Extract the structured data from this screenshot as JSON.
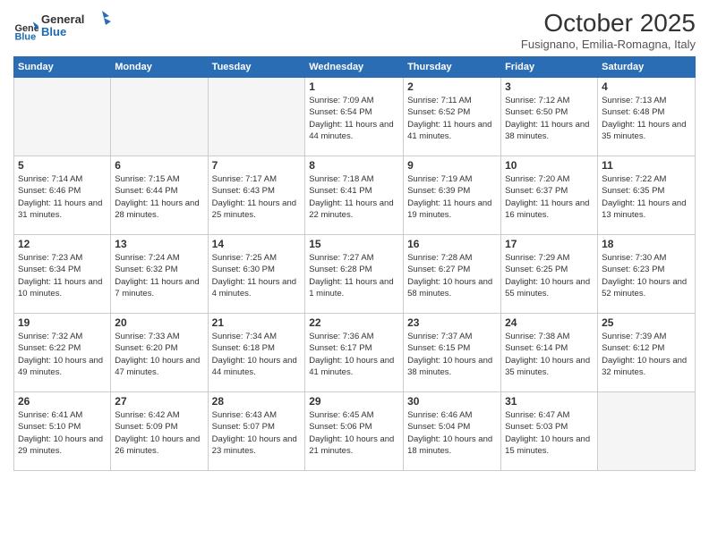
{
  "header": {
    "logo_line1": "General",
    "logo_line2": "Blue",
    "month": "October 2025",
    "location": "Fusignano, Emilia-Romagna, Italy"
  },
  "days_of_week": [
    "Sunday",
    "Monday",
    "Tuesday",
    "Wednesday",
    "Thursday",
    "Friday",
    "Saturday"
  ],
  "weeks": [
    [
      {
        "day": "",
        "info": ""
      },
      {
        "day": "",
        "info": ""
      },
      {
        "day": "",
        "info": ""
      },
      {
        "day": "1",
        "info": "Sunrise: 7:09 AM\nSunset: 6:54 PM\nDaylight: 11 hours and 44 minutes."
      },
      {
        "day": "2",
        "info": "Sunrise: 7:11 AM\nSunset: 6:52 PM\nDaylight: 11 hours and 41 minutes."
      },
      {
        "day": "3",
        "info": "Sunrise: 7:12 AM\nSunset: 6:50 PM\nDaylight: 11 hours and 38 minutes."
      },
      {
        "day": "4",
        "info": "Sunrise: 7:13 AM\nSunset: 6:48 PM\nDaylight: 11 hours and 35 minutes."
      }
    ],
    [
      {
        "day": "5",
        "info": "Sunrise: 7:14 AM\nSunset: 6:46 PM\nDaylight: 11 hours and 31 minutes."
      },
      {
        "day": "6",
        "info": "Sunrise: 7:15 AM\nSunset: 6:44 PM\nDaylight: 11 hours and 28 minutes."
      },
      {
        "day": "7",
        "info": "Sunrise: 7:17 AM\nSunset: 6:43 PM\nDaylight: 11 hours and 25 minutes."
      },
      {
        "day": "8",
        "info": "Sunrise: 7:18 AM\nSunset: 6:41 PM\nDaylight: 11 hours and 22 minutes."
      },
      {
        "day": "9",
        "info": "Sunrise: 7:19 AM\nSunset: 6:39 PM\nDaylight: 11 hours and 19 minutes."
      },
      {
        "day": "10",
        "info": "Sunrise: 7:20 AM\nSunset: 6:37 PM\nDaylight: 11 hours and 16 minutes."
      },
      {
        "day": "11",
        "info": "Sunrise: 7:22 AM\nSunset: 6:35 PM\nDaylight: 11 hours and 13 minutes."
      }
    ],
    [
      {
        "day": "12",
        "info": "Sunrise: 7:23 AM\nSunset: 6:34 PM\nDaylight: 11 hours and 10 minutes."
      },
      {
        "day": "13",
        "info": "Sunrise: 7:24 AM\nSunset: 6:32 PM\nDaylight: 11 hours and 7 minutes."
      },
      {
        "day": "14",
        "info": "Sunrise: 7:25 AM\nSunset: 6:30 PM\nDaylight: 11 hours and 4 minutes."
      },
      {
        "day": "15",
        "info": "Sunrise: 7:27 AM\nSunset: 6:28 PM\nDaylight: 11 hours and 1 minute."
      },
      {
        "day": "16",
        "info": "Sunrise: 7:28 AM\nSunset: 6:27 PM\nDaylight: 10 hours and 58 minutes."
      },
      {
        "day": "17",
        "info": "Sunrise: 7:29 AM\nSunset: 6:25 PM\nDaylight: 10 hours and 55 minutes."
      },
      {
        "day": "18",
        "info": "Sunrise: 7:30 AM\nSunset: 6:23 PM\nDaylight: 10 hours and 52 minutes."
      }
    ],
    [
      {
        "day": "19",
        "info": "Sunrise: 7:32 AM\nSunset: 6:22 PM\nDaylight: 10 hours and 49 minutes."
      },
      {
        "day": "20",
        "info": "Sunrise: 7:33 AM\nSunset: 6:20 PM\nDaylight: 10 hours and 47 minutes."
      },
      {
        "day": "21",
        "info": "Sunrise: 7:34 AM\nSunset: 6:18 PM\nDaylight: 10 hours and 44 minutes."
      },
      {
        "day": "22",
        "info": "Sunrise: 7:36 AM\nSunset: 6:17 PM\nDaylight: 10 hours and 41 minutes."
      },
      {
        "day": "23",
        "info": "Sunrise: 7:37 AM\nSunset: 6:15 PM\nDaylight: 10 hours and 38 minutes."
      },
      {
        "day": "24",
        "info": "Sunrise: 7:38 AM\nSunset: 6:14 PM\nDaylight: 10 hours and 35 minutes."
      },
      {
        "day": "25",
        "info": "Sunrise: 7:39 AM\nSunset: 6:12 PM\nDaylight: 10 hours and 32 minutes."
      }
    ],
    [
      {
        "day": "26",
        "info": "Sunrise: 6:41 AM\nSunset: 5:10 PM\nDaylight: 10 hours and 29 minutes."
      },
      {
        "day": "27",
        "info": "Sunrise: 6:42 AM\nSunset: 5:09 PM\nDaylight: 10 hours and 26 minutes."
      },
      {
        "day": "28",
        "info": "Sunrise: 6:43 AM\nSunset: 5:07 PM\nDaylight: 10 hours and 23 minutes."
      },
      {
        "day": "29",
        "info": "Sunrise: 6:45 AM\nSunset: 5:06 PM\nDaylight: 10 hours and 21 minutes."
      },
      {
        "day": "30",
        "info": "Sunrise: 6:46 AM\nSunset: 5:04 PM\nDaylight: 10 hours and 18 minutes."
      },
      {
        "day": "31",
        "info": "Sunrise: 6:47 AM\nSunset: 5:03 PM\nDaylight: 10 hours and 15 minutes."
      },
      {
        "day": "",
        "info": ""
      }
    ]
  ]
}
